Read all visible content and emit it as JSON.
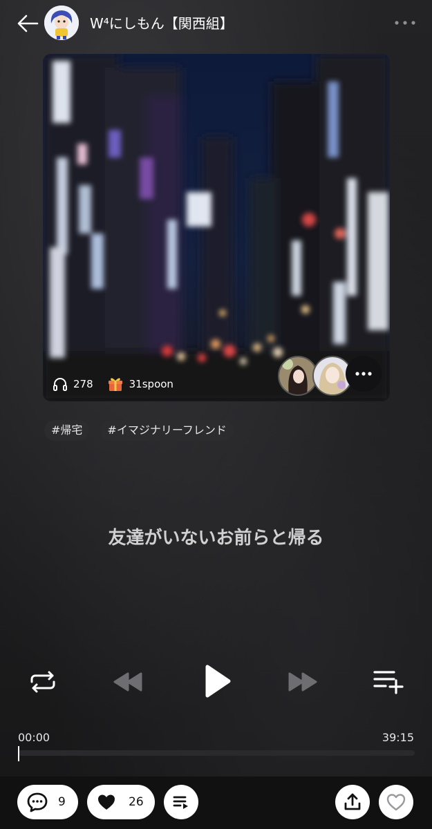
{
  "header": {
    "author_name": "W⁴にしもん【関西組】"
  },
  "cover": {
    "listen_count": "278",
    "spoon_label": "31spoon"
  },
  "tags": [
    "#帰宅",
    "#イマジナリーフレンド"
  ],
  "cast_title": "友達がいないお前らと帰る",
  "player": {
    "current_time": "00:00",
    "total_time": "39:15",
    "progress_fraction": 0.0
  },
  "bottom_bar": {
    "comment_count": "9",
    "like_count": "26"
  },
  "icons": {
    "back": "back-arrow-icon",
    "more": "more-icon",
    "headphones": "headphones-icon",
    "gift": "gift-icon",
    "repeat": "repeat-icon",
    "rewind": "rewind-icon",
    "play": "play-icon",
    "fast_forward": "fast-forward-icon",
    "add_queue": "playlist-add-icon",
    "comment": "comment-icon",
    "like": "heart-icon",
    "playlist": "playlist-icon",
    "share": "share-icon",
    "favorite": "heart-outline-icon"
  }
}
